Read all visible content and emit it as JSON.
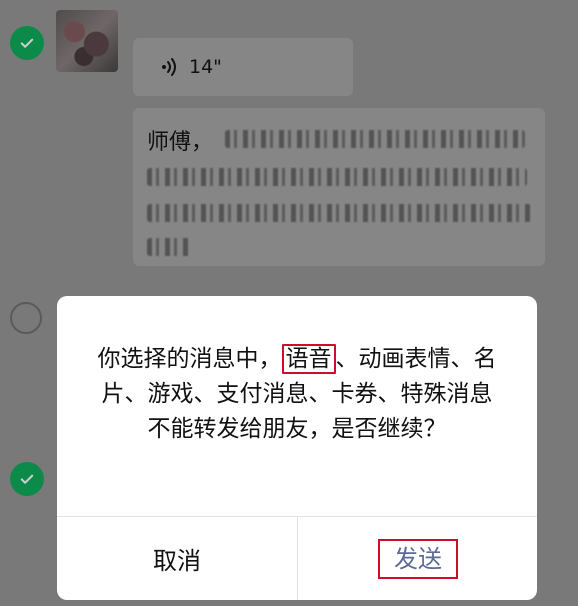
{
  "chat": {
    "voice_duration": "14\"",
    "text_message_lead": "师傅，"
  },
  "dialog": {
    "message_part1": "你选择的消息中，",
    "message_highlight": "语音",
    "message_part2": "、动画表情、名片、游戏、支付消息、卡券、特殊消息不能转发给朋友，是否继续？",
    "cancel_label": "取消",
    "send_label": "发送"
  },
  "colors": {
    "check_green": "#0b8a4a",
    "highlight_red": "#c8102e",
    "send_text": "#5b6b95"
  }
}
